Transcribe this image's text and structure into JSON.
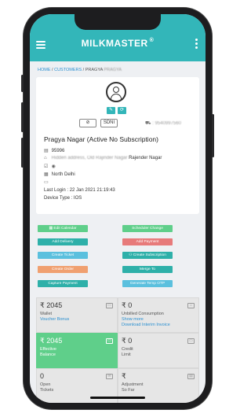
{
  "app": {
    "brand": "MILKMASTER",
    "brand_mark": "®"
  },
  "breadcrumb": {
    "home": "HOME",
    "sep1": " / ",
    "customers": "CUSTOMERS",
    "sep2": " / ",
    "current": "PRAGYA",
    "current_blurred": "PRAGYA"
  },
  "profile": {
    "edit_icon": "✎",
    "refresh_icon": "⟳",
    "pill_icon": "⊘",
    "tag": "SDNI",
    "phone_icon": "⛟",
    "phone": ": 9540997560",
    "name": "Pragya Nagar (Active No Subscription)",
    "id_icon": "▤",
    "id": "95996",
    "address_icon": "⌂",
    "address_blurred": "Hidden address, Old Rajinder Nagar",
    "address_area": "Rajender Nagar",
    "check_icon": "☑",
    "eye_icon": "◉",
    "region_icon": "▦",
    "region": "North Delhi",
    "cal_icon": "▭",
    "last_login": "Last Login : 22 Jan 2021 21:19:43",
    "device": "Device Type : IOS"
  },
  "actions": [
    {
      "label": "Edit Calendar",
      "icon": "▦",
      "color": "#5fcf8a"
    },
    {
      "label": "Scheduler Change",
      "color": "#5fcf8a"
    },
    {
      "label": "Add Delivery",
      "color": "#2eb0a9"
    },
    {
      "label": "Add Payment",
      "color": "#e77a7a"
    },
    {
      "label": "Create Ticket",
      "color": "#5bc0de"
    },
    {
      "label": "Create Subscription",
      "icon": "⚇",
      "color": "#2eb0a9"
    },
    {
      "label": "Create Order",
      "color": "#f0a070"
    },
    {
      "label": "Merge To",
      "color": "#2eb0a9"
    },
    {
      "label": "Capture Payment",
      "color": "#2eb0a9"
    },
    {
      "label": "Generate Temp OTP",
      "color": "#5bc0de"
    }
  ],
  "stats": {
    "wallet": {
      "value": "₹ 2045",
      "label": "Wallet",
      "sub": "Voucher Bonus",
      "icon": "▭"
    },
    "unbilled": {
      "value": "₹ 0",
      "label": "Unbilled Consumption",
      "show_more": "Show more",
      "sub": "Download Interim Invoice",
      "icon": "⌂"
    },
    "effective": {
      "value": "₹ 2045",
      "label": "Effective",
      "label2": "Balance",
      "icon": "▭"
    },
    "credit": {
      "value": "₹ 0",
      "label": "Credit",
      "label2": "Limit",
      "icon": "▭"
    },
    "tickets": {
      "value": "0",
      "label": "Open",
      "label2": "Tickets",
      "icon": "✉"
    },
    "adjustment": {
      "value": "₹",
      "label": "Adjustment",
      "label2": "So Far",
      "icon": "▤"
    }
  },
  "colors": {
    "header": "#33b6b9",
    "accent_link": "#2a8fd0",
    "green_tile": "#5fcf8a"
  }
}
